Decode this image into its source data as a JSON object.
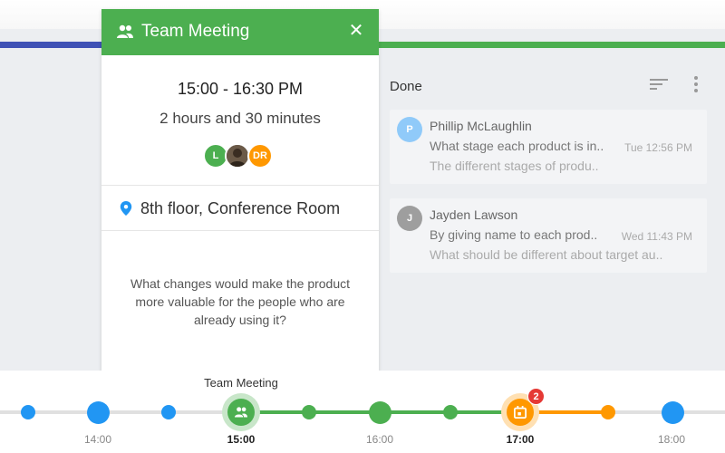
{
  "event_card": {
    "title": "Team Meeting",
    "close_symbol": "✕",
    "time_range": "15:00 - 16:30 PM",
    "duration": "2 hours and 30 minutes",
    "attendees": [
      {
        "initials": "L",
        "color": "#4caf50"
      },
      {
        "initials": "",
        "color": "#5d4e3f"
      },
      {
        "initials": "DR",
        "color": "#ff9800"
      }
    ],
    "location": "8th floor, Conference Room",
    "question": "What changes would make the product more valuable for the people who are already using it?",
    "header_color": "#4caf50"
  },
  "messages": {
    "header_title": "Done",
    "items": [
      {
        "avatar": "P",
        "avatar_color": "#90caf9",
        "sender": "Phillip McLaughlin",
        "subject": "What stage each product is in..",
        "time": "Tue 12:56 PM",
        "preview": "The different stages of produ.."
      },
      {
        "avatar": "J",
        "avatar_color": "#9e9e9e",
        "sender": "Jayden Lawson",
        "subject": "By giving name to each prod..",
        "time": "Wed 11:43 PM",
        "preview": "What should be different about target au.."
      }
    ]
  },
  "timeline": {
    "event_label": "Team Meeting",
    "badge_count": "2",
    "labels": [
      "14:00",
      "15:00",
      "16:00",
      "17:00",
      "18:00"
    ],
    "colors": {
      "blue": "#2196f3",
      "green": "#4caf50",
      "orange": "#ff9800",
      "badge": "#e53935"
    }
  }
}
